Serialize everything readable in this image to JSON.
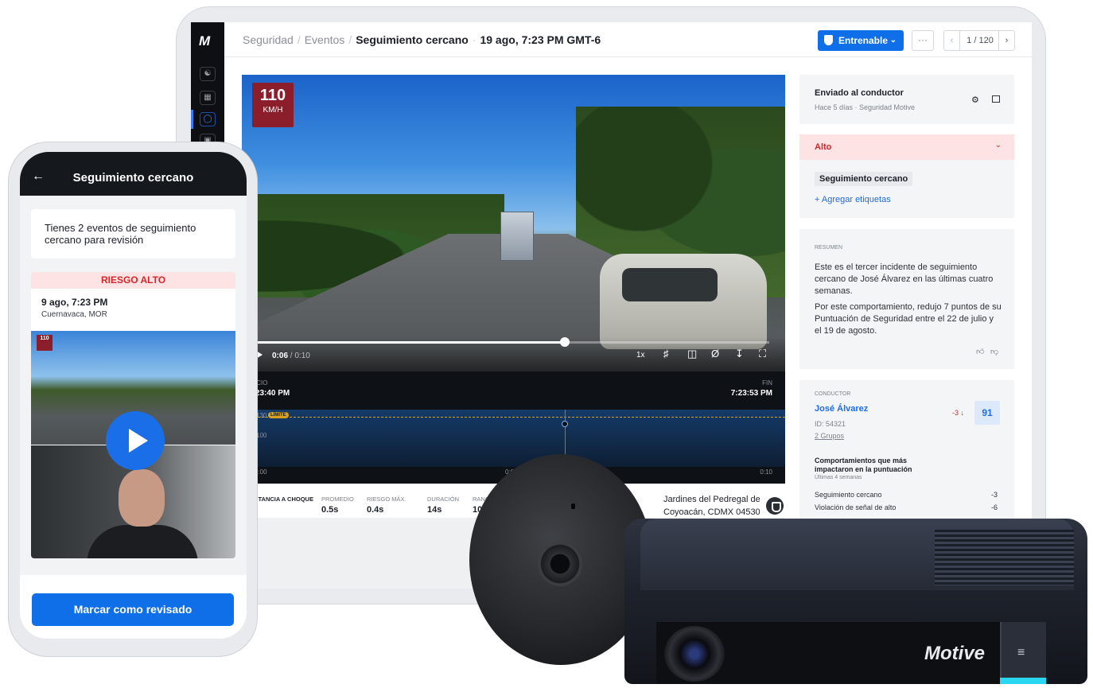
{
  "app": {
    "logo": "M"
  },
  "breadcrumb": {
    "root": "Seguridad",
    "section": "Eventos",
    "event": "Seguimiento cercano",
    "datetime": "19 ago, 7:23 PM GMT-6"
  },
  "toolbar": {
    "trainable": "Entrenable",
    "more": "···",
    "pager": "1 / 120"
  },
  "video": {
    "speed_value": "110",
    "speed_unit": "KM/H",
    "time_current": "0:06",
    "time_total": "/ 0:10",
    "rate": "1x",
    "progress": 0.6
  },
  "timeline": {
    "start_label": "INICIO",
    "start_time": "7:23:40 PM",
    "end_label": "FIN",
    "end_time": "7:23:53 PM",
    "limit_label": "LÍMITE",
    "y_top": "130",
    "y_mid": "100",
    "x_start": "0:00",
    "x_mid": "0:05",
    "x_end": "0:10"
  },
  "metrics": [
    {
      "label": "DISTANCIA A CHOQUE",
      "value": ""
    },
    {
      "label": "PROMEDIO",
      "value": "0.5s"
    },
    {
      "label": "RIESGO MÁX.",
      "value": "0.4s"
    },
    {
      "label": "DURACIÓN",
      "value": "14s"
    },
    {
      "label": "RANGO",
      "value": "10"
    }
  ],
  "location": {
    "line1": "Jardines del Pedregal de",
    "line2": "Coyoacán, CDMX 04530"
  },
  "panel": {
    "sent_title": "Enviado al conductor",
    "sent_sub": "Hace 5 días · Seguridad Motive",
    "severity": "Alto",
    "tag": "Seguimiento cercano",
    "add_tags": "+ Agregar etiquetas",
    "summary_label": "RESUMEN",
    "summary_p1": "Este es el tercer incidente de seguimiento cercano de José Álvarez en las últimas cuatro semanas.",
    "summary_p2": "Por este comportamiento, redujo 7 puntos de su Puntuación de Seguridad entre el 22 de julio y el 19 de agosto.",
    "driver_label": "CONDUCTOR",
    "driver_name": "José Álvarez",
    "driver_id": "ID: 54321",
    "driver_groups": "2 Grupos",
    "score_delta": "-3",
    "score": "91",
    "behaviors_title": "Comportamientos que más impactaron en la puntuación",
    "behaviors_sub": "Últimas 4 semanas",
    "behaviors": [
      {
        "name": "Seguimiento cercano",
        "value": "-3"
      },
      {
        "name": "Violación de señal de alto",
        "value": "-6"
      }
    ]
  },
  "phone": {
    "title": "Seguimiento cercano",
    "message": "Tienes 2 eventos de seguimiento cercano para revisión",
    "risk": "RIESGO ALTO",
    "date": "9 ago, 7:23 PM",
    "location": "Cuernavaca, MOR",
    "speed": "110",
    "mark_reviewed": "Marcar como revisado"
  },
  "device": {
    "brand": "Motive"
  }
}
